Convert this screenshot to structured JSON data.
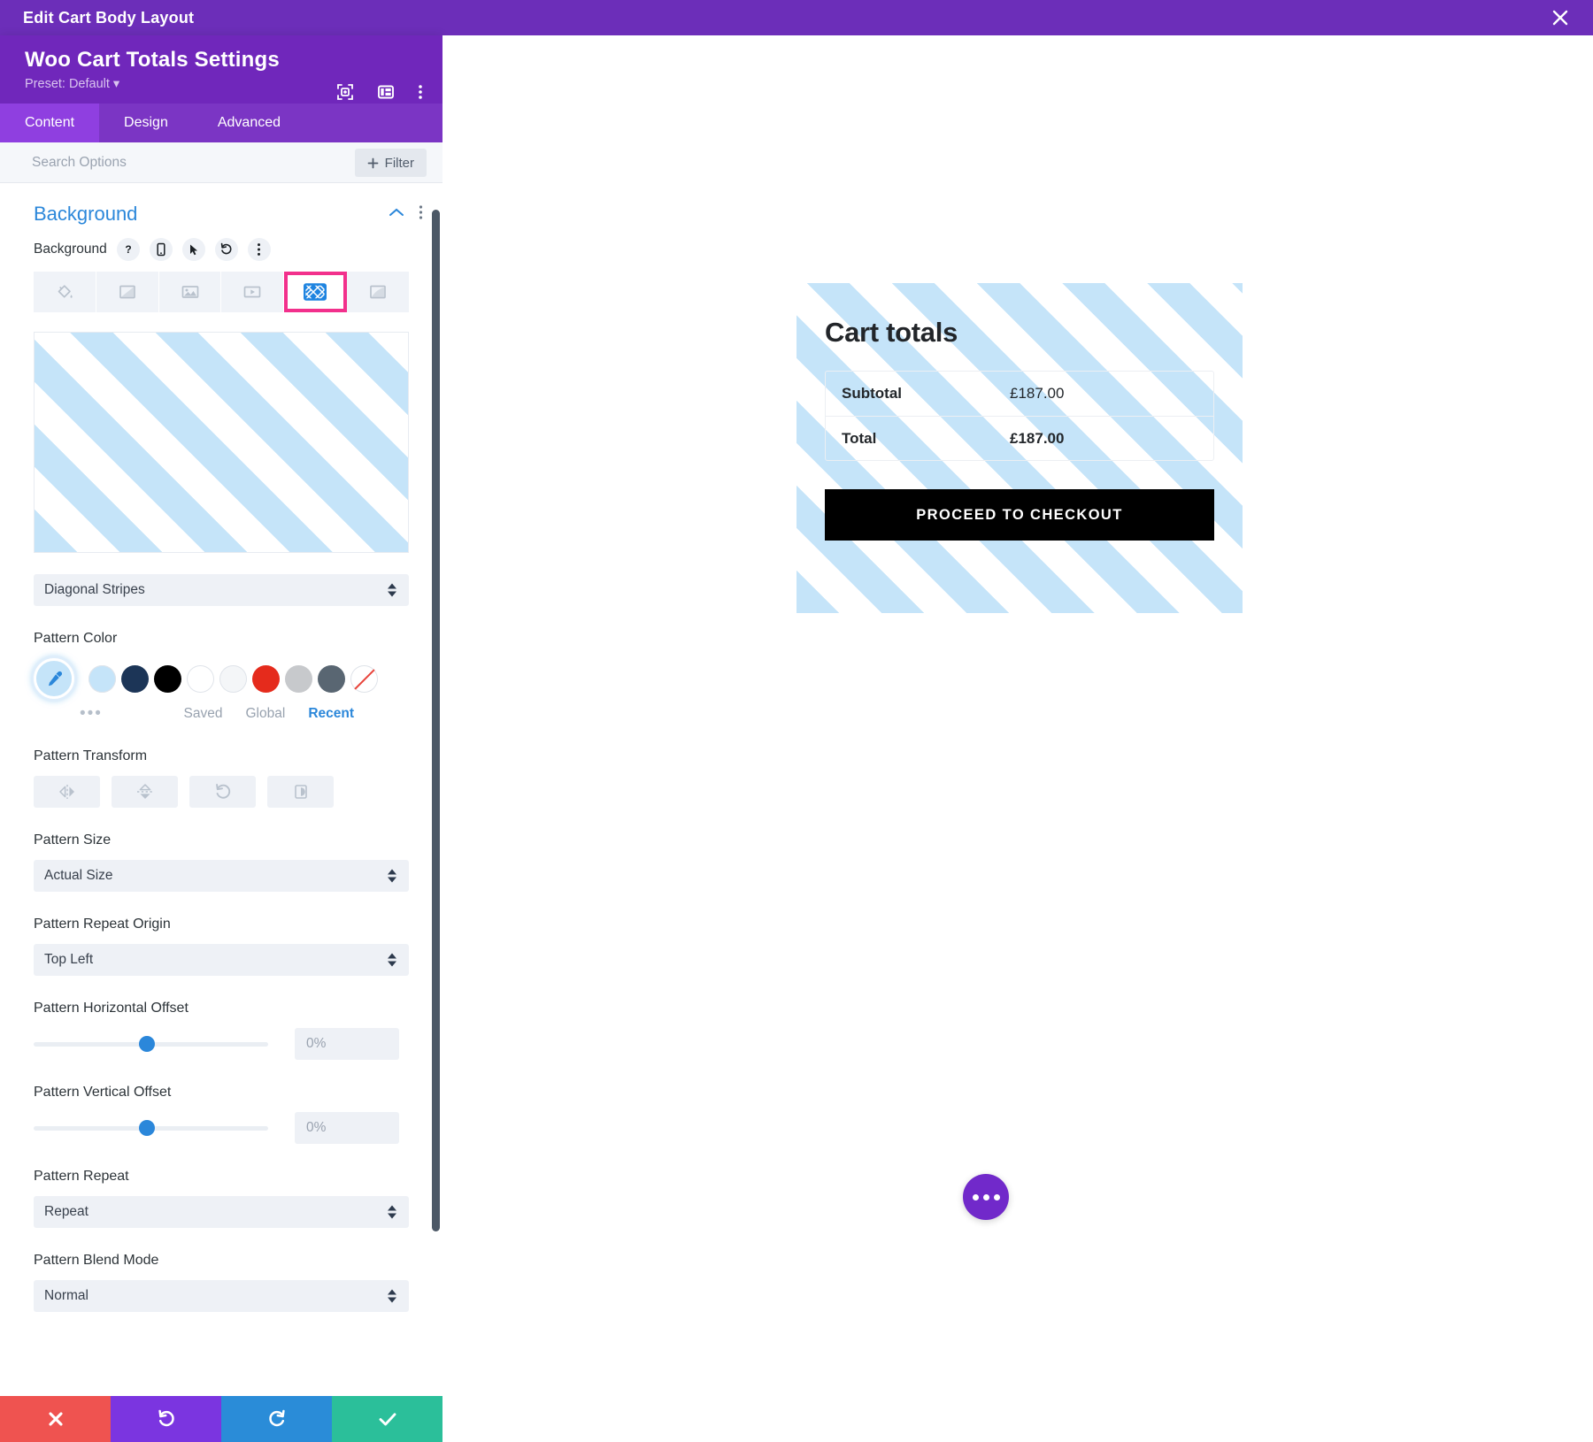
{
  "window": {
    "title": "Edit Cart Body Layout",
    "close_icon": "close-icon"
  },
  "panel": {
    "title": "Woo Cart Totals Settings",
    "preset": "Preset: Default ▾",
    "head_icons": [
      "focus-target-icon",
      "layout-columns-icon",
      "kebab-menu-icon"
    ],
    "tabs": [
      {
        "label": "Content",
        "active": true
      },
      {
        "label": "Design",
        "active": false
      },
      {
        "label": "Advanced",
        "active": false
      }
    ],
    "search": {
      "placeholder": "Search Options",
      "value": ""
    },
    "filter_button": "Filter",
    "section": {
      "title": "Background",
      "collapse_icon": "chevron-up-icon",
      "menu_icon": "kebab-menu-icon"
    },
    "background_row": {
      "label": "Background",
      "icons": [
        "help-icon",
        "responsive-phone-icon",
        "hover-cursor-icon",
        "reset-undo-icon",
        "kebab-menu-icon"
      ]
    },
    "background_types": [
      {
        "name": "color-background-tab",
        "icon": "paint-bucket-icon",
        "selected": false
      },
      {
        "name": "gradient-background-tab",
        "icon": "gradient-icon",
        "selected": false
      },
      {
        "name": "image-background-tab",
        "icon": "image-icon",
        "selected": false
      },
      {
        "name": "video-background-tab",
        "icon": "video-icon",
        "selected": false
      },
      {
        "name": "pattern-background-tab",
        "icon": "pattern-icon",
        "selected": true
      },
      {
        "name": "mask-background-tab",
        "icon": "mask-icon",
        "selected": false
      }
    ],
    "pattern": {
      "style_select": "Diagonal Stripes",
      "color_label": "Pattern Color",
      "color_swatches": [
        {
          "name": "swatch-light-blue",
          "hex": "#c5e4f9"
        },
        {
          "name": "swatch-navy",
          "hex": "#1c3557"
        },
        {
          "name": "swatch-black",
          "hex": "#000000"
        },
        {
          "name": "swatch-white",
          "hex": "#ffffff"
        },
        {
          "name": "swatch-offwhite",
          "hex": "#f4f6f8"
        },
        {
          "name": "swatch-red",
          "hex": "#e52b1c"
        },
        {
          "name": "swatch-light-gray",
          "hex": "#c7c9cc"
        },
        {
          "name": "swatch-dark-gray",
          "hex": "#596672"
        },
        {
          "name": "swatch-none",
          "hex": "transparent"
        }
      ],
      "eyedropper_icon": "eyedropper-icon",
      "more_colors": "•••",
      "palette_tabs": [
        {
          "label": "Saved",
          "active": false
        },
        {
          "label": "Global",
          "active": false
        },
        {
          "label": "Recent",
          "active": true
        }
      ],
      "transform_label": "Pattern Transform",
      "transform_buttons": [
        {
          "name": "flip-horizontal-button",
          "icon": "flip-horizontal-icon"
        },
        {
          "name": "flip-vertical-button",
          "icon": "flip-vertical-icon"
        },
        {
          "name": "rotate-button",
          "icon": "rotate-ccw-icon"
        },
        {
          "name": "invert-button",
          "icon": "invert-contrast-icon"
        }
      ],
      "size_label": "Pattern Size",
      "size_value": "Actual Size",
      "repeat_origin_label": "Pattern Repeat Origin",
      "repeat_origin_value": "Top Left",
      "horizontal_offset_label": "Pattern Horizontal Offset",
      "horizontal_offset_value": "0%",
      "vertical_offset_label": "Pattern Vertical Offset",
      "vertical_offset_value": "0%",
      "repeat_label": "Pattern Repeat",
      "repeat_value": "Repeat",
      "blend_mode_label": "Pattern Blend Mode",
      "blend_mode_value": "Normal"
    },
    "actions": [
      {
        "name": "cancel-button",
        "icon": "close-x-icon",
        "color": "#ef5350"
      },
      {
        "name": "undo-button",
        "icon": "undo-icon",
        "color": "#7b35e0"
      },
      {
        "name": "redo-button",
        "icon": "redo-icon",
        "color": "#2a8cd8"
      },
      {
        "name": "save-button",
        "icon": "checkmark-icon",
        "color": "#2bbf9a"
      }
    ]
  },
  "canvas": {
    "cart": {
      "title": "Cart totals",
      "rows": [
        {
          "label": "Subtotal",
          "value": "£187.00",
          "bold_value": false
        },
        {
          "label": "Total",
          "value": "£187.00",
          "bold_value": true
        }
      ],
      "checkout_button": "PROCEED TO CHECKOUT"
    },
    "fab_icon": "more-options-icon"
  },
  "colors": {
    "brand_purple": "#6c2eb9",
    "panel_purple": "#7027bb",
    "tab_active": "#8f3fe0",
    "accent_blue": "#2b87da",
    "highlight_pink": "#f2308c",
    "pattern_blue": "#c5e4f9"
  }
}
